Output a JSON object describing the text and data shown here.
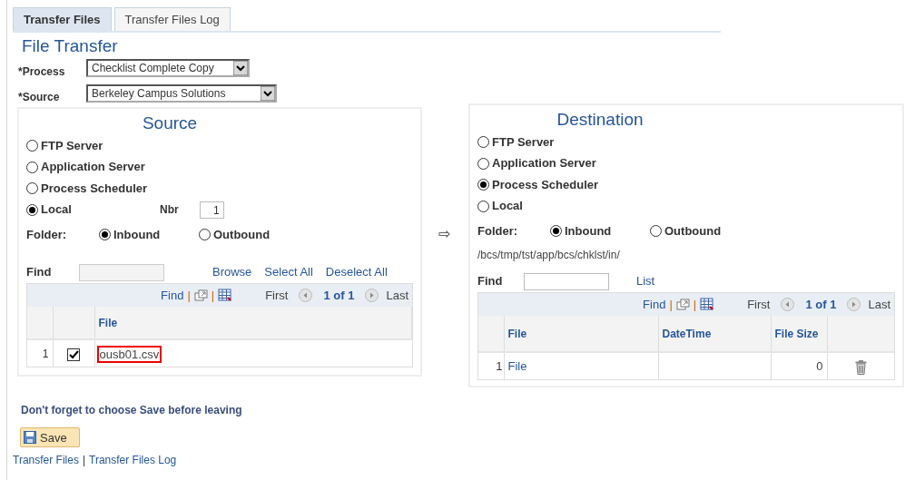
{
  "tabs": [
    {
      "label": "Transfer Files",
      "selected": true
    },
    {
      "label": "Transfer Files Log",
      "selected": false
    }
  ],
  "title": "File Transfer",
  "fields": [
    {
      "label": "*Process",
      "value": "Checklist Complete Copy"
    },
    {
      "label": "*Source",
      "value": "Berkeley Campus Solutions"
    }
  ],
  "source": {
    "heading": "Source",
    "options": [
      {
        "label": "FTP Server",
        "selected": false
      },
      {
        "label": "Application Server",
        "selected": false
      },
      {
        "label": "Process Scheduler",
        "selected": false
      },
      {
        "label": "Local",
        "selected": true
      }
    ],
    "nbr_label": "Nbr",
    "nbr_value": "1",
    "folder_label": "Folder:",
    "folder_options": [
      {
        "label": "Inbound",
        "selected": true
      },
      {
        "label": "Outbound",
        "selected": false
      }
    ],
    "find_label": "Find",
    "links": [
      "Browse",
      "Select All",
      "Deselect All"
    ],
    "grid": {
      "nav": {
        "find": "Find",
        "separator": "|",
        "first": "First",
        "counter": "1 of 1",
        "last": "Last"
      },
      "columns": [
        "File"
      ],
      "rows": [
        {
          "row_number": "1",
          "checked": true,
          "file": "ousb01.csv",
          "highlighted": true
        }
      ]
    }
  },
  "arrow": "⇨",
  "destination": {
    "heading": "Destination",
    "options": [
      {
        "label": "FTP Server",
        "selected": false
      },
      {
        "label": "Application Server",
        "selected": false
      },
      {
        "label": "Process Scheduler",
        "selected": true
      },
      {
        "label": "Local",
        "selected": false
      }
    ],
    "folder_label": "Folder:",
    "folder_options": [
      {
        "label": "Inbound",
        "selected": true
      },
      {
        "label": "Outbound",
        "selected": false
      }
    ],
    "path": "/bcs/tmp/tst/app/bcs/chklst/in/",
    "find_label": "Find",
    "list_link": "List",
    "grid": {
      "nav": {
        "find": "Find",
        "separator": "|",
        "first": "First",
        "counter": "1 of 1",
        "last": "Last"
      },
      "columns": [
        "File",
        "DateTime",
        "File Size"
      ],
      "rows": [
        {
          "row_number": "1",
          "file": "File",
          "size": "0"
        }
      ]
    }
  },
  "note": "Don't forget to choose Save before leaving",
  "save_button": "Save",
  "footer_links": [
    "Transfer Files",
    "Transfer Files Log"
  ],
  "footer_separator": "|"
}
